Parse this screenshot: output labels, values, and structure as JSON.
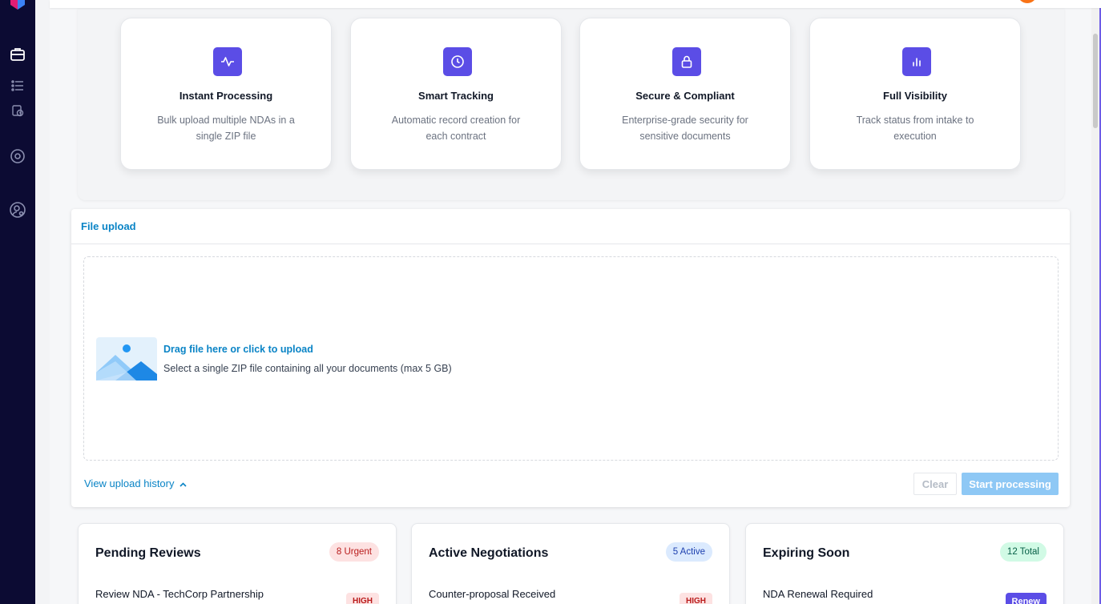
{
  "features": [
    {
      "icon": "activity-icon",
      "title": "Instant Processing",
      "desc": "Bulk upload multiple NDAs in a single ZIP file"
    },
    {
      "icon": "clock-icon",
      "title": "Smart Tracking",
      "desc": "Automatic record creation for each contract"
    },
    {
      "icon": "lock-icon",
      "title": "Secure & Compliant",
      "desc": "Enterprise-grade security for sensitive documents"
    },
    {
      "icon": "bar-chart-icon",
      "title": "Full Visibility",
      "desc": "Track status from intake to execution"
    }
  ],
  "upload": {
    "header": "File upload",
    "primary": "Drag file here or click to upload",
    "secondary": "Select a single ZIP file containing all your documents (max 5 GB)",
    "history_link": "View upload history",
    "clear_label": "Clear",
    "start_label": "Start processing"
  },
  "stats": [
    {
      "title": "Pending Reviews",
      "badge": "8 Urgent",
      "item": "Review NDA - TechCorp Partnership",
      "tag": "HIGH"
    },
    {
      "title": "Active Negotiations",
      "badge": "5 Active",
      "item": "Counter-proposal Received",
      "tag": "HIGH"
    },
    {
      "title": "Expiring Soon",
      "badge": "12 Total",
      "item": "NDA Renewal Required",
      "tag": "Renew"
    }
  ],
  "colors": {
    "sidebar": "#0c0b33",
    "accent": "#5b4de6",
    "link": "#0a84c6",
    "primary_button_disabled": "#8ec8f5",
    "urgent_badge": "#fde2e2",
    "active_badge": "#dbeafe",
    "total_badge": "#d1fae5"
  }
}
